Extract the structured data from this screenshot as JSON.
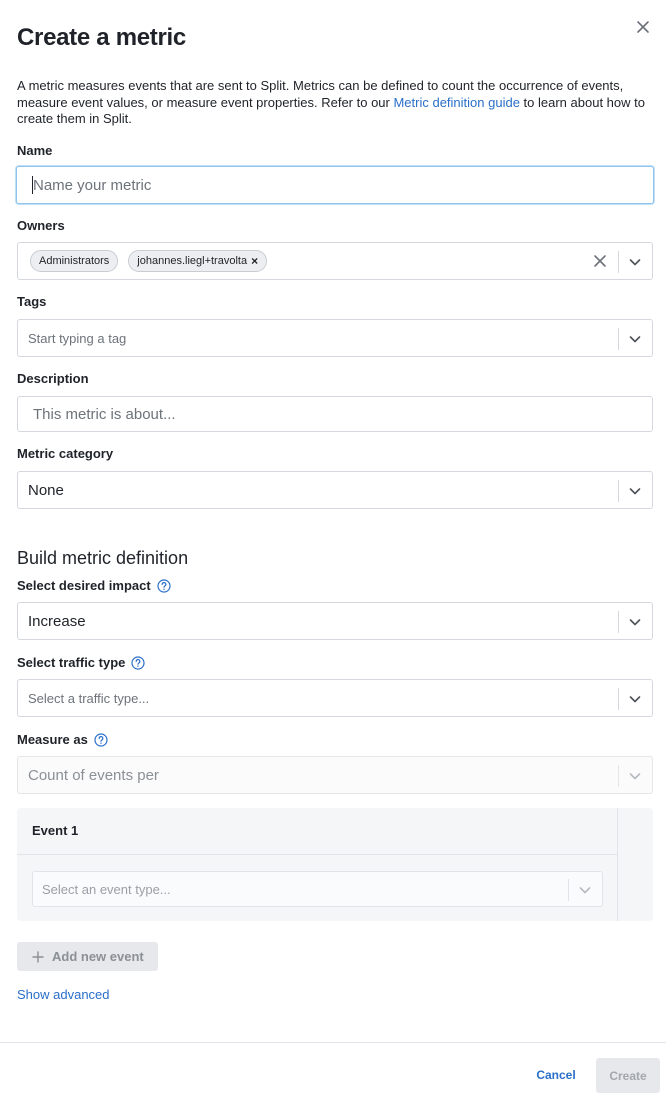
{
  "modal": {
    "title": "Create a metric",
    "close_icon": "close-icon"
  },
  "intro": {
    "text_before": "A metric measures events that are sent to Split. Metrics can be defined to count the occurrence of events, measure event values, or measure event properties. Refer to our ",
    "link": "Metric definition guide",
    "text_after": " to learn about how to create them in Split."
  },
  "name": {
    "label": "Name",
    "placeholder": "Name your metric"
  },
  "owners": {
    "label": "Owners",
    "chips": [
      "Administrators",
      "johannes.liegl+travolta"
    ]
  },
  "tags": {
    "label": "Tags",
    "placeholder": "Start typing a tag"
  },
  "description": {
    "label": "Description",
    "placeholder": "This metric is about..."
  },
  "category": {
    "label": "Metric category",
    "value": "None"
  },
  "definition": {
    "section_title": "Build metric definition",
    "impact": {
      "label": "Select desired impact",
      "value": "Increase"
    },
    "traffic": {
      "label": "Select traffic type",
      "placeholder": "Select a traffic type..."
    },
    "measure": {
      "label": "Measure as",
      "value": "Count of events per"
    },
    "event": {
      "title": "Event 1",
      "placeholder": "Select an event type..."
    },
    "add_event": "Add new event",
    "show_advanced": "Show advanced"
  },
  "footer": {
    "cancel": "Cancel",
    "create": "Create"
  },
  "colors": {
    "link": "#2a6fc9",
    "focus_border": "#8fc5ec",
    "help_icon": "#2a6fc9"
  }
}
